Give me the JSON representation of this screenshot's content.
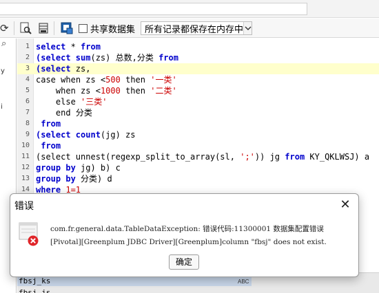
{
  "toolbar": {
    "share_label": "共享数据集",
    "share_checked": false,
    "storage_select_value": "所有记录都保存在内存中"
  },
  "editor": {
    "highlight_line": 3,
    "lines": [
      {
        "num": "1"
      },
      {
        "num": "2"
      },
      {
        "num": "3"
      },
      {
        "num": "4"
      },
      {
        "num": "5"
      },
      {
        "num": "6"
      },
      {
        "num": "7"
      },
      {
        "num": "8"
      },
      {
        "num": "9"
      },
      {
        "num": "10"
      },
      {
        "num": "11"
      },
      {
        "num": "12"
      },
      {
        "num": "13"
      },
      {
        "num": "14"
      }
    ],
    "tokens": {
      "select": "select",
      "star": " * ",
      "from": "from",
      "open_select": "(select ",
      "sum": "sum",
      "sum_args": "(zs) 总数,分类 ",
      "zs_comma": "zs,",
      "case": "case",
      "when": "when",
      "zs_lt": " zs <",
      "n500": "500",
      "then": "then",
      "s1": "'一类'",
      "n1000": "1000",
      "s2": "'二类'",
      "else": "else",
      "s3": "'三类'",
      "end": "end",
      "end_rest": " 分类",
      "count": "count",
      "count_args": "(jg) zs",
      "unnest_pre": "(select unnest(regexp_split_to_array(sl, ",
      "semi": "';'",
      "unnest_post": ")) jg ",
      "table_a": " KY_QKLWSJ) a",
      "group": "group",
      "by": "by",
      "by_jg": " jg) b) c",
      "by_cat": " 分类) d",
      "where": "where",
      "cond": " 1=1"
    }
  },
  "bottom": {
    "row1": "fbsj_ks",
    "row2": "fbsj_js",
    "abc": "ABC"
  },
  "dialog": {
    "title": "错误",
    "line1": "com.fr.general.data.TableDataException: 错误代码:11300001 数据集配置错误",
    "line2": "[Pivotal][Greenplum JDBC Driver][Greenplum]column \"fbsj\" does not exist.",
    "ok_label": "确定",
    "icon": "error-icon"
  },
  "left_panel": {
    "chars": [
      "y",
      "i"
    ]
  }
}
